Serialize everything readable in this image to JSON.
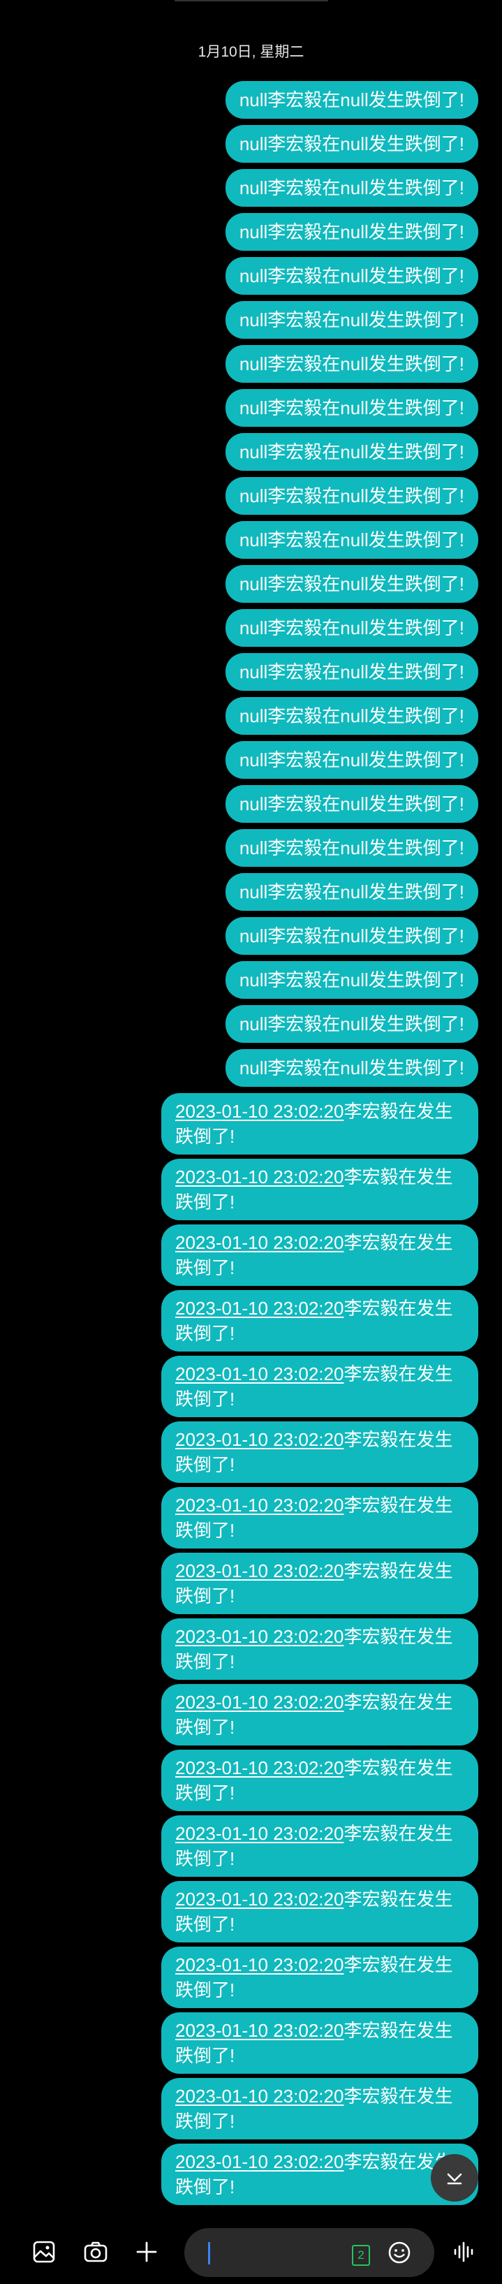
{
  "header": {
    "date": "1月10日, 星期二"
  },
  "messages_short": [
    "null李宏毅在null发生跌倒了!",
    "null李宏毅在null发生跌倒了!",
    "null李宏毅在null发生跌倒了!",
    "null李宏毅在null发生跌倒了!",
    "null李宏毅在null发生跌倒了!",
    "null李宏毅在null发生跌倒了!",
    "null李宏毅在null发生跌倒了!",
    "null李宏毅在null发生跌倒了!",
    "null李宏毅在null发生跌倒了!",
    "null李宏毅在null发生跌倒了!",
    "null李宏毅在null发生跌倒了!",
    "null李宏毅在null发生跌倒了!",
    "null李宏毅在null发生跌倒了!",
    "null李宏毅在null发生跌倒了!",
    "null李宏毅在null发生跌倒了!",
    "null李宏毅在null发生跌倒了!",
    "null李宏毅在null发生跌倒了!",
    "null李宏毅在null发生跌倒了!",
    "null李宏毅在null发生跌倒了!",
    "null李宏毅在null发生跌倒了!",
    "null李宏毅在null发生跌倒了!",
    "null李宏毅在null发生跌倒了!",
    "null李宏毅在null发生跌倒了!"
  ],
  "messages_long": [
    {
      "timestamp": "2023-01-10 23:02:20",
      "text": "李宏毅在发生跌倒了!"
    },
    {
      "timestamp": "2023-01-10 23:02:20",
      "text": "李宏毅在发生跌倒了!"
    },
    {
      "timestamp": "2023-01-10 23:02:20",
      "text": "李宏毅在发生跌倒了!"
    },
    {
      "timestamp": "2023-01-10 23:02:20",
      "text": "李宏毅在发生跌倒了!"
    },
    {
      "timestamp": "2023-01-10 23:02:20",
      "text": "李宏毅在发生跌倒了!"
    },
    {
      "timestamp": "2023-01-10 23:02:20",
      "text": "李宏毅在发生跌倒了!"
    },
    {
      "timestamp": "2023-01-10 23:02:20",
      "text": "李宏毅在发生跌倒了!"
    },
    {
      "timestamp": "2023-01-10 23:02:20",
      "text": "李宏毅在发生跌倒了!"
    },
    {
      "timestamp": "2023-01-10 23:02:20",
      "text": "李宏毅在发生跌倒了!"
    },
    {
      "timestamp": "2023-01-10 23:02:20",
      "text": "李宏毅在发生跌倒了!"
    },
    {
      "timestamp": "2023-01-10 23:02:20",
      "text": "李宏毅在发生跌倒了!"
    },
    {
      "timestamp": "2023-01-10 23:02:20",
      "text": "李宏毅在发生跌倒了!"
    },
    {
      "timestamp": "2023-01-10 23:02:20",
      "text": "李宏毅在发生跌倒了!"
    },
    {
      "timestamp": "2023-01-10 23:02:20",
      "text": "李宏毅在发生跌倒了!"
    },
    {
      "timestamp": "2023-01-10 23:02:20",
      "text": "李宏毅在发生跌倒了!"
    },
    {
      "timestamp": "2023-01-10 23:02:20",
      "text": "李宏毅在发生跌倒了!"
    },
    {
      "timestamp": "2023-01-10 23:02:20",
      "text": "李宏毅在发生跌倒了!"
    }
  ],
  "composer": {
    "input_value": "",
    "sim_label": "2",
    "icons": {
      "gallery": "gallery-icon",
      "camera": "camera-icon",
      "add": "plus-icon",
      "emoji": "emoji-icon",
      "voice": "voice-wave-icon",
      "scroll_down": "chevron-down-icon"
    }
  },
  "colors": {
    "bubble": "#10b9bd",
    "background": "#000000",
    "sim": "#22c55e",
    "caret": "#3b82f6"
  }
}
